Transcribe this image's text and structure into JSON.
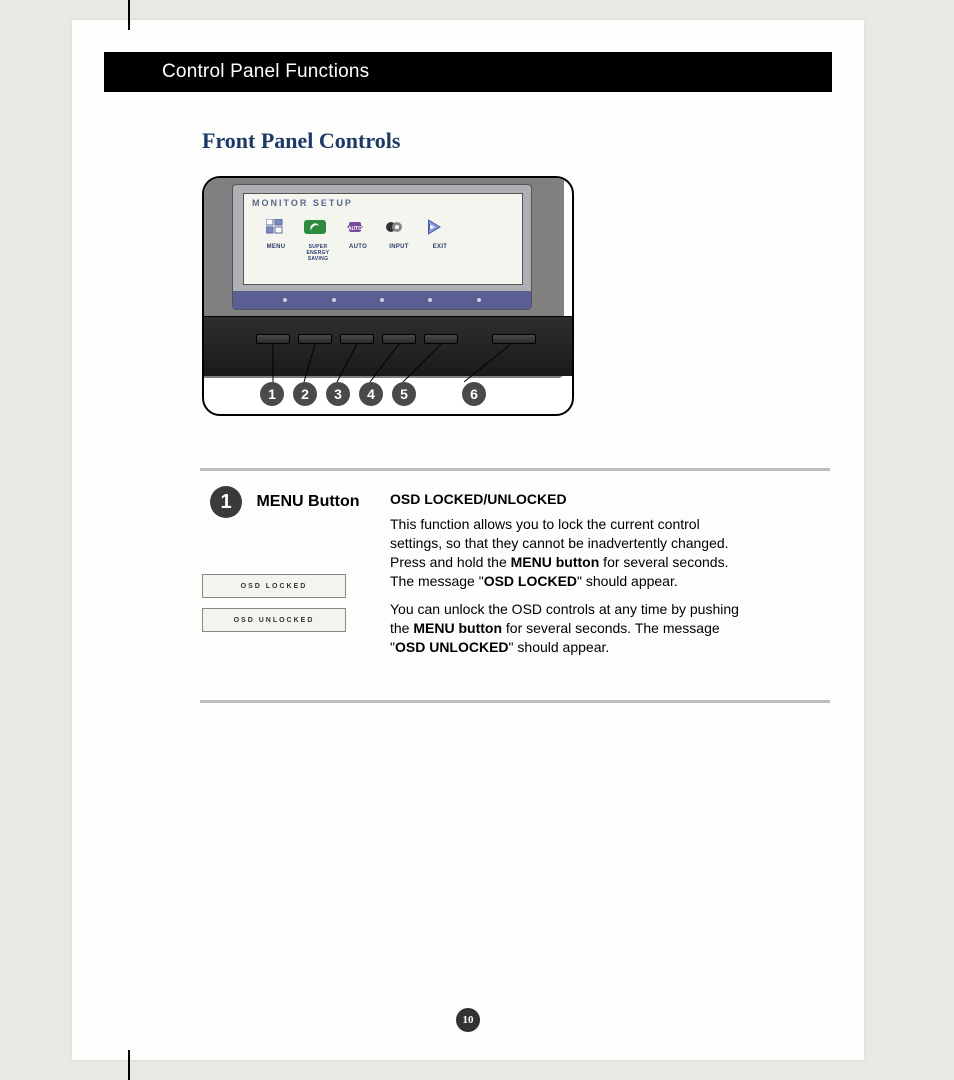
{
  "header": {
    "title": "Control Panel Functions"
  },
  "section_title": "Front Panel Controls",
  "monitor": {
    "screen_title": "MONITOR SETUP",
    "labels": {
      "menu": "MENU",
      "ses": "SUPER ENERGY SAVING",
      "auto": "AUTO",
      "input": "INPUT",
      "exit": "EXIT"
    },
    "callouts": [
      "1",
      "2",
      "3",
      "4",
      "5",
      "6"
    ]
  },
  "section1": {
    "badge": "1",
    "label": "MENU Button",
    "osd_boxes": [
      "OSD LOCKED",
      "OSD UNLOCKED"
    ],
    "heading": "OSD LOCKED/UNLOCKED",
    "para1_a": "This function allows you to lock the current control settings, so that they cannot be inadvertently changed. Press and hold the ",
    "para1_b": "MENU button",
    "para1_c": " for several seconds. The message \"",
    "para1_d": "OSD LOCKED",
    "para1_e": "\" should appear.",
    "para2_a": "You can unlock the OSD controls at any time by pushing the ",
    "para2_b": "MENU button",
    "para2_c": " for several seconds. The message \"",
    "para2_d": "OSD UNLOCKED",
    "para2_e": "\" should appear."
  },
  "page_number": "10"
}
